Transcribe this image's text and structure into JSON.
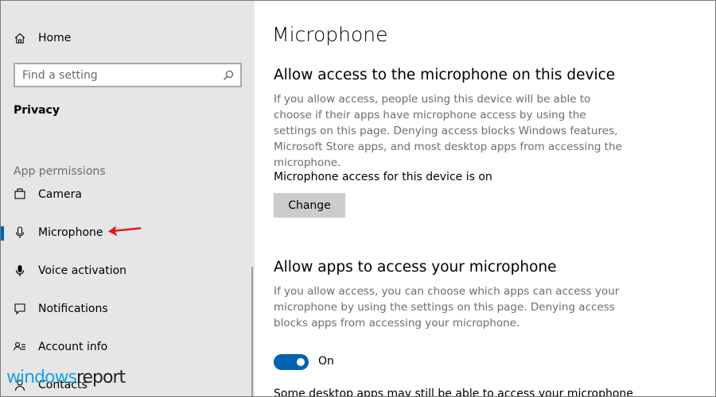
{
  "sidebar": {
    "home_label": "Home",
    "search_placeholder": "Find a setting",
    "category": "Privacy",
    "section_header": "App permissions",
    "items": [
      {
        "label": "Camera",
        "icon": "camera-icon"
      },
      {
        "label": "Microphone",
        "icon": "microphone-icon",
        "selected": true
      },
      {
        "label": "Voice activation",
        "icon": "voice-activation-icon"
      },
      {
        "label": "Notifications",
        "icon": "notifications-icon"
      },
      {
        "label": "Account info",
        "icon": "account-info-icon"
      },
      {
        "label": "Contacts",
        "icon": "contacts-icon"
      }
    ]
  },
  "main": {
    "title": "Microphone",
    "device_section": {
      "heading": "Allow access to the microphone on this device",
      "description": "If you allow access, people using this device will be able to choose if their apps have microphone access by using the settings on this page. Denying access blocks Windows features, Microsoft Store apps, and most desktop apps from accessing the microphone.",
      "status": "Microphone access for this device is on",
      "button": "Change"
    },
    "apps_section": {
      "heading": "Allow apps to access your microphone",
      "description": "If you allow access, you can choose which apps can access your microphone by using the settings on this page. Denying access blocks apps from accessing your microphone.",
      "toggle_label": "On",
      "toggle_on": true,
      "footer_text": "Some desktop apps may still be able to access your microphone"
    }
  },
  "watermark": {
    "part1": "windows",
    "part2": "report"
  },
  "colors": {
    "accent": "#0063b1",
    "sidebar_bg": "#e6e6e6",
    "annotation_arrow": "#e8141b",
    "watermark_blue": "#1aa3e8"
  }
}
